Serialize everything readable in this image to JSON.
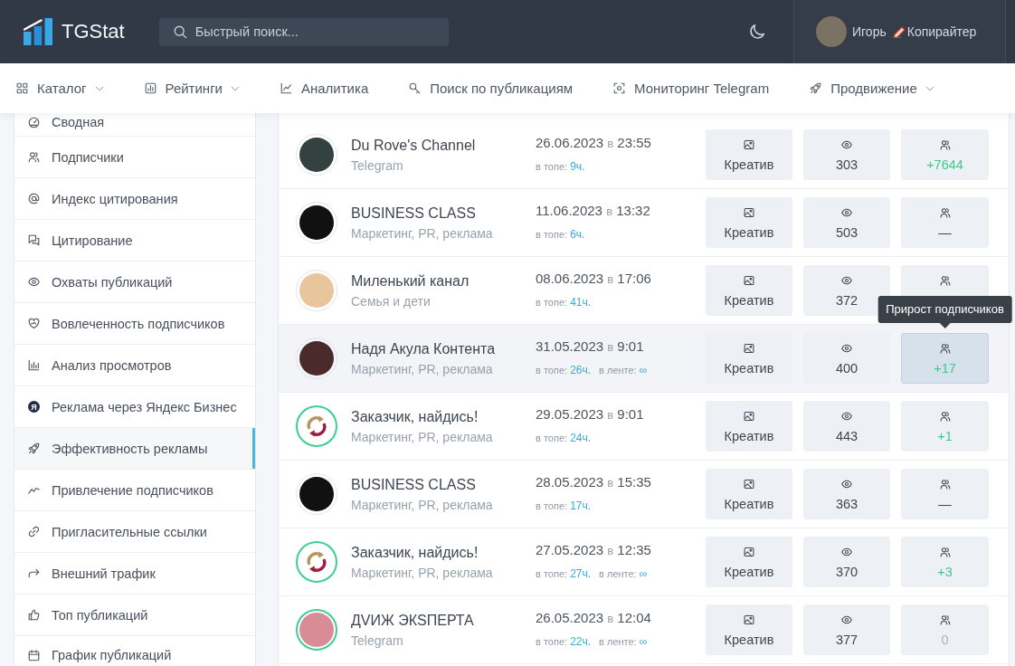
{
  "header": {
    "logo": "TGStat",
    "search": {
      "placeholder": "Быстрый поиск..."
    },
    "user": {
      "name": "Игорь",
      "role": "Копирайтер"
    }
  },
  "nav": [
    {
      "label": "Каталог",
      "dropdown": true
    },
    {
      "label": "Рейтинги",
      "dropdown": true
    },
    {
      "label": "Аналитика",
      "dropdown": false
    },
    {
      "label": "Поиск по публикациям",
      "dropdown": false
    },
    {
      "label": "Мониторинг Telegram",
      "dropdown": false
    },
    {
      "label": "Продвижение",
      "dropdown": true
    }
  ],
  "sidebar": {
    "items": [
      {
        "label": "Сводная",
        "selected": false
      },
      {
        "label": "Подписчики",
        "selected": false
      },
      {
        "label": "Индекс цитирования",
        "selected": false
      },
      {
        "label": "Цитирование",
        "selected": false
      },
      {
        "label": "Охваты публикаций",
        "selected": false
      },
      {
        "label": "Вовлеченность подписчиков",
        "selected": false
      },
      {
        "label": "Анализ просмотров",
        "selected": false
      },
      {
        "label": "Реклама через Яндекс Бизнес",
        "icon_letter": "Я",
        "selected": false
      },
      {
        "label": "Эффективность рекламы",
        "selected": true
      },
      {
        "label": "Привлечение подписчиков",
        "selected": false
      },
      {
        "label": "Пригласительные ссылки",
        "selected": false
      },
      {
        "label": "Внешний трафик",
        "selected": false
      },
      {
        "label": "Топ публикаций",
        "selected": false
      },
      {
        "label": "График публикаций",
        "selected": false
      }
    ]
  },
  "feed": {
    "rows": [
      {
        "hovered": false,
        "avatar": {
          "kind": "photo",
          "color": "#33413f",
          "ring": false
        },
        "name": "Du Rove's Channel",
        "category": "Telegram",
        "date": "26.06.2023",
        "date_joiner": "в",
        "time": "23:55",
        "stats": [
          {
            "label": "в топе:",
            "value": "9ч."
          }
        ],
        "creative": "Креатив",
        "views": "303",
        "subscribers": {
          "value": "+7644",
          "color": "#3fc98a",
          "hovered": false
        }
      },
      {
        "hovered": false,
        "avatar": {
          "kind": "photo",
          "color": "#111111",
          "ring": false
        },
        "name": "BUSINESS CLASS",
        "category": "Маркетинг, PR, реклама",
        "date": "11.06.2023",
        "date_joiner": "в",
        "time": "13:32",
        "stats": [
          {
            "label": "в топе:",
            "value": "6ч."
          }
        ],
        "creative": "Креатив",
        "views": "503",
        "subscribers": {
          "value": "—",
          "color": "#3e4651",
          "hovered": false
        }
      },
      {
        "hovered": false,
        "avatar": {
          "kind": "photo",
          "color": "#e8c59b",
          "ring": false
        },
        "name": "Миленький канал",
        "category": "Семья и дети",
        "date": "08.06.2023",
        "date_joiner": "в",
        "time": "17:06",
        "stats": [
          {
            "label": "в топе:",
            "value": "41ч."
          }
        ],
        "creative": "Креатив",
        "views": "372",
        "subscribers": {
          "hovered": false
        }
      },
      {
        "hovered": true,
        "avatar": {
          "kind": "photo",
          "color": "#4a2a2a",
          "ring": false
        },
        "name": "Надя Акула Контента",
        "category": "Маркетинг, PR, реклама",
        "date": "31.05.2023",
        "date_joiner": "в",
        "time": "9:01",
        "stats": [
          {
            "label": "в топе:",
            "value": "26ч."
          },
          {
            "label": "в ленте:",
            "value": "∞"
          }
        ],
        "creative": "Креатив",
        "views": "400",
        "subscribers": {
          "value": "+17",
          "color": "#3fc98a",
          "hovered": true,
          "tooltip": "Прирост подписчиков"
        }
      },
      {
        "hovered": false,
        "avatar": {
          "kind": "logo",
          "ring": true
        },
        "name": "Заказчик, найдись!",
        "category": "Маркетинг, PR, реклама",
        "date": "29.05.2023",
        "date_joiner": "в",
        "time": "9:01",
        "stats": [
          {
            "label": "в топе:",
            "value": "24ч."
          }
        ],
        "creative": "Креатив",
        "views": "443",
        "subscribers": {
          "value": "+1",
          "color": "#3fc98a",
          "hovered": false
        }
      },
      {
        "hovered": false,
        "avatar": {
          "kind": "photo",
          "color": "#111111",
          "ring": false
        },
        "name": "BUSINESS CLASS",
        "category": "Маркетинг, PR, реклама",
        "date": "28.05.2023",
        "date_joiner": "в",
        "time": "15:35",
        "stats": [
          {
            "label": "в топе:",
            "value": "17ч."
          }
        ],
        "creative": "Креатив",
        "views": "363",
        "subscribers": {
          "value": "—",
          "color": "#3e4651",
          "hovered": false
        }
      },
      {
        "hovered": false,
        "avatar": {
          "kind": "logo",
          "ring": true
        },
        "name": "Заказчик, найдись!",
        "category": "Маркетинг, PR, реклама",
        "date": "27.05.2023",
        "date_joiner": "в",
        "time": "12:35",
        "stats": [
          {
            "label": "в топе:",
            "value": "27ч."
          },
          {
            "label": "в ленте:",
            "value": "∞"
          }
        ],
        "creative": "Креатив",
        "views": "370",
        "subscribers": {
          "value": "+3",
          "color": "#3fc98a",
          "hovered": false
        }
      },
      {
        "hovered": false,
        "avatar": {
          "kind": "photo",
          "color": "#d98c96",
          "ring": true
        },
        "name": "ДVИЖ ЭКSПЕРТА",
        "category": "Telegram",
        "date": "26.05.2023",
        "date_joiner": "в",
        "time": "12:04",
        "stats": [
          {
            "label": "в топе:",
            "value": "22ч."
          },
          {
            "label": "в ленте:",
            "value": "∞"
          }
        ],
        "creative": "Креатив",
        "views": "377",
        "subscribers": {
          "value": "0",
          "color": "#aab3bd",
          "hovered": false
        }
      }
    ]
  }
}
